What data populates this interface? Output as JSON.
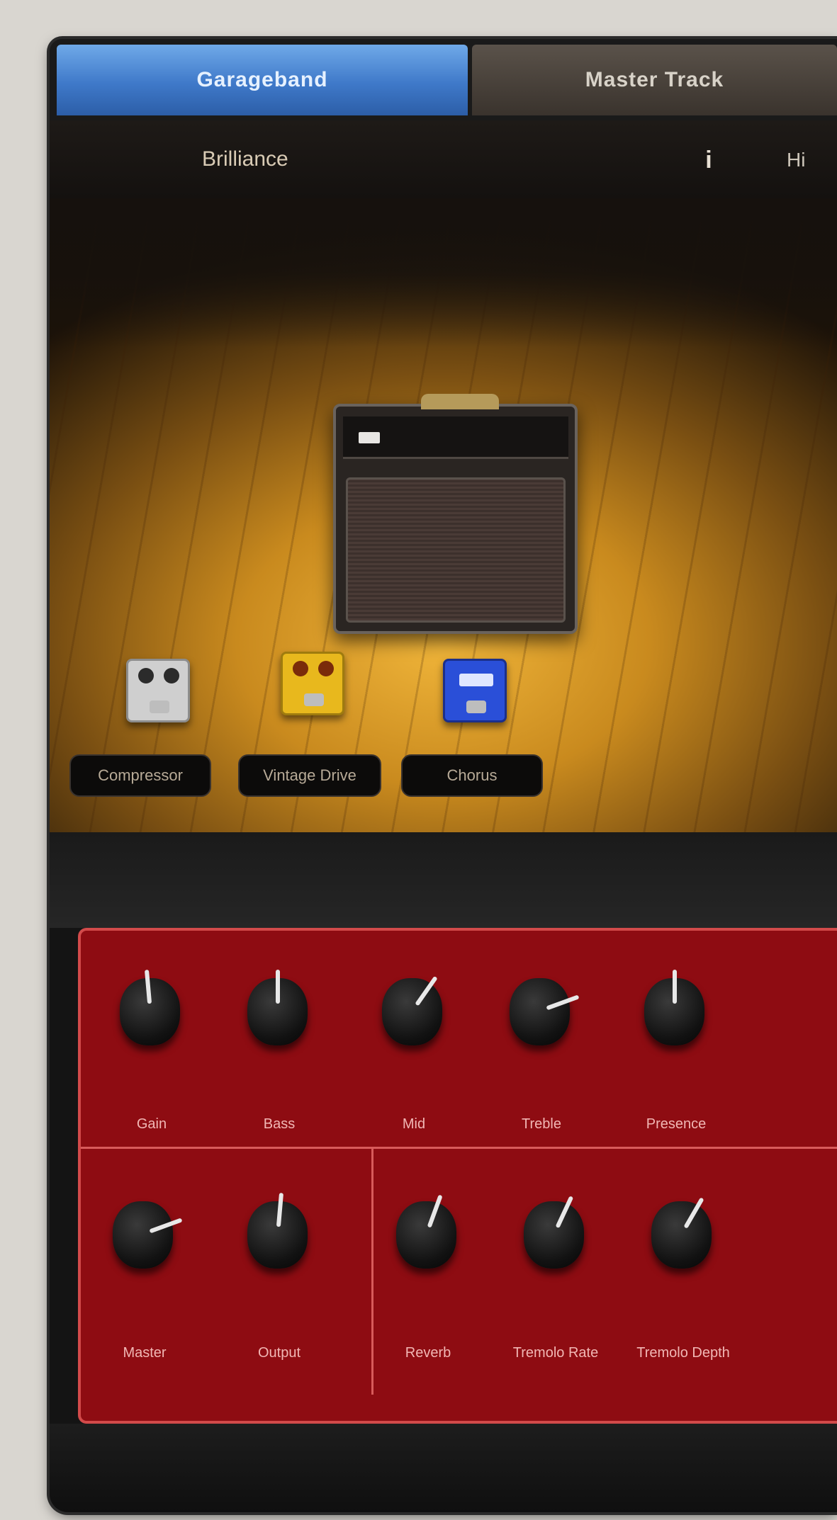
{
  "tabs": {
    "active_label": "Garageband",
    "inactive_label": "Master Track"
  },
  "preset_bar": {
    "preset_name": "Brilliance",
    "info_glyph": "i",
    "right_label": "Hi"
  },
  "pedals": [
    {
      "name": "Compressor",
      "color": "#cfcfcf"
    },
    {
      "name": "Vintage Drive",
      "color": "#e8b81d"
    },
    {
      "name": "Chorus",
      "color": "#2a4fd8"
    }
  ],
  "amp": {
    "model_color": "#2a2522"
  },
  "controls": {
    "row1": [
      {
        "label": "Gain",
        "angle": -5
      },
      {
        "label": "Bass",
        "angle": 0
      },
      {
        "label": "Mid",
        "angle": 35
      },
      {
        "label": "Treble",
        "angle": 70
      },
      {
        "label": "Presence",
        "angle": 0
      }
    ],
    "row2": [
      {
        "label": "Master",
        "angle": 70
      },
      {
        "label": "Output",
        "angle": 5
      },
      {
        "label": "Reverb",
        "angle": 20
      },
      {
        "label": "Tremolo Rate",
        "angle": 25
      },
      {
        "label": "Tremolo Depth",
        "angle": 30
      }
    ]
  },
  "colors": {
    "accent_tab": "#3f79c9",
    "panel_red": "#8e0c12",
    "panel_border": "#d24a4a",
    "stage_wood": "#c98a1e"
  }
}
